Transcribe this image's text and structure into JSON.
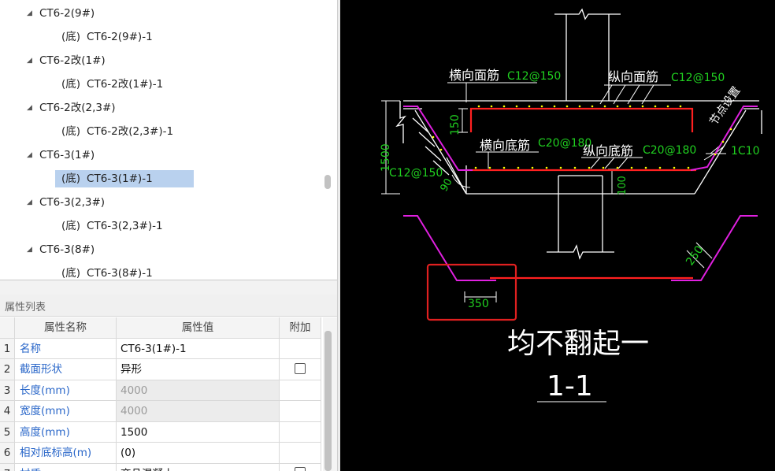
{
  "tree": {
    "items": [
      {
        "label": "CT6-2(9#)",
        "prefix": "",
        "level": 0
      },
      {
        "label": "CT6-2(9#)-1",
        "prefix": "(底)",
        "level": 1
      },
      {
        "label": "CT6-2改(1#)",
        "prefix": "",
        "level": 0
      },
      {
        "label": "CT6-2改(1#)-1",
        "prefix": "(底)",
        "level": 1
      },
      {
        "label": "CT6-2改(2,3#)",
        "prefix": "",
        "level": 0
      },
      {
        "label": "CT6-2改(2,3#)-1",
        "prefix": "(底)",
        "level": 1
      },
      {
        "label": "CT6-3(1#)",
        "prefix": "",
        "level": 0
      },
      {
        "label": "CT6-3(1#)-1",
        "prefix": "(底)",
        "level": 1,
        "selected": true
      },
      {
        "label": "CT6-3(2,3#)",
        "prefix": "",
        "level": 0
      },
      {
        "label": "CT6-3(2,3#)-1",
        "prefix": "(底)",
        "level": 1
      },
      {
        "label": "CT6-3(8#)",
        "prefix": "",
        "level": 0
      },
      {
        "label": "CT6-3(8#)-1",
        "prefix": "(底)",
        "level": 1
      }
    ]
  },
  "props": {
    "title": "属性列表",
    "headers": {
      "name": "属性名称",
      "value": "属性值",
      "extra": "附加"
    },
    "rows": [
      {
        "idx": "1",
        "name": "名称",
        "value": "CT6-3(1#)-1",
        "readonly": false,
        "checkbox": false
      },
      {
        "idx": "2",
        "name": "截面形状",
        "value": "异形",
        "readonly": false,
        "checkbox": true
      },
      {
        "idx": "3",
        "name": "长度(mm)",
        "value": "4000",
        "readonly": true,
        "checkbox": false
      },
      {
        "idx": "4",
        "name": "宽度(mm)",
        "value": "4000",
        "readonly": true,
        "checkbox": false
      },
      {
        "idx": "5",
        "name": "高度(mm)",
        "value": "1500",
        "readonly": false,
        "checkbox": false
      },
      {
        "idx": "6",
        "name": "相对底标高(m)",
        "value": "(0)",
        "readonly": false,
        "checkbox": false
      },
      {
        "idx": "7",
        "name": "材质",
        "value": "商品混凝土",
        "readonly": false,
        "checkbox": true
      }
    ]
  },
  "cad": {
    "labels": {
      "top_transverse": "横向面筋",
      "top_transverse_val": "C12@150",
      "top_longitudinal": "纵向面筋",
      "top_longitudinal_val": "C12@150",
      "bottom_transverse": "横向底筋",
      "bottom_transverse_val": "C20@180",
      "bottom_longitudinal": "纵向底筋",
      "bottom_longitudinal_val": "C20@180",
      "dim_height": "1500",
      "dim_150": "150",
      "dim_100": "100",
      "side_bar": "C12@150",
      "angle": "90",
      "corner_bar": "1C10",
      "dim_250": "250",
      "dim_350": "350",
      "note_rotated": "节点设置",
      "annotation": "均不翻起一",
      "section_label": "1-1"
    },
    "colors": {
      "background": "#000000",
      "outline": "#ffffff",
      "rebar_red": "#ff2020",
      "rebar_magenta": "#e020e0",
      "dim_green": "#20d020",
      "dot_yellow": "#ffff00",
      "highlight_box": "#e02020"
    }
  }
}
